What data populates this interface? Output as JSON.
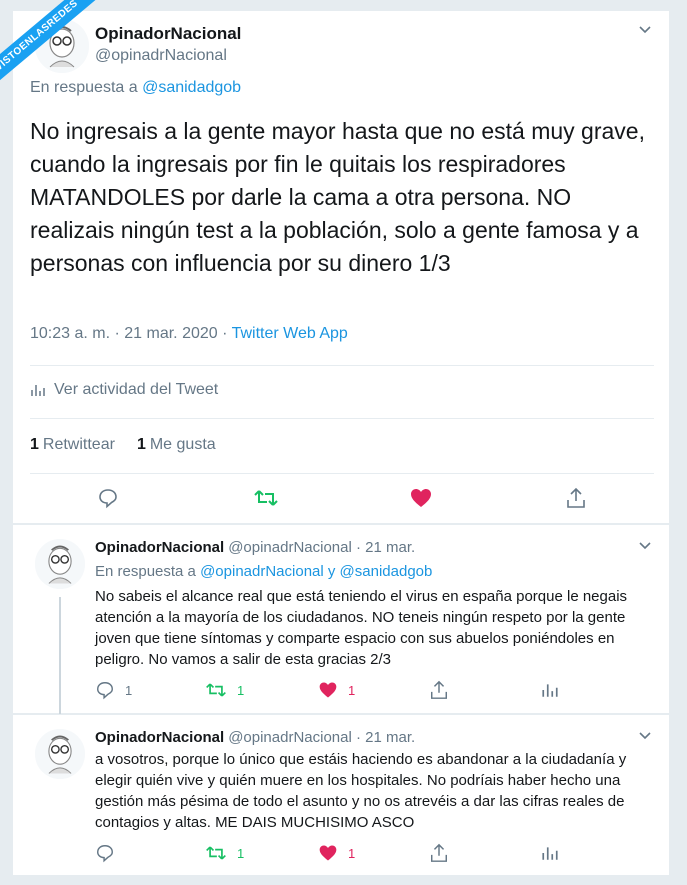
{
  "watermark": "VISTOENLASREDES",
  "colors": {
    "accent": "#1b95e0",
    "retweet_green": "#17bf63",
    "like_pink": "#e0245e",
    "muted": "#657786"
  },
  "main_tweet": {
    "name": "OpinadorNacional",
    "handle": "@opinadrNacional",
    "reply_prefix": "En respuesta a",
    "reply_to": "@sanidadgob",
    "text": "No ingresais a la gente mayor hasta que no está muy grave, cuando la ingresais por fin le quitais los respiradores MATANDOLES por darle la cama a otra persona. NO realizais ningún test a la población, solo a gente famosa y a personas con influencia por su dinero 1/3",
    "timestamp": "10:23 a. m. · 21 mar. 2020 ·",
    "source": "Twitter Web App",
    "activity_label": "Ver actividad del Tweet",
    "retweets_count": "1",
    "retweets_label": "Retwittear",
    "likes_count": "1",
    "likes_label": "Me gusta"
  },
  "replies": [
    {
      "name": "OpinadorNacional",
      "handle_date": "@opinadrNacional · 21 mar.",
      "reply_prefix": "En respuesta a",
      "reply_to": "@opinadrNacional y @sanidadgob",
      "text": "No sabeis el alcance real que está teniendo el virus en españa porque le negais atención a la mayoría de los ciudadanos. NO teneis ningún respeto por la gente joven que tiene síntomas y comparte espacio con sus abuelos poniéndoles en peligro. No vamos a salir de esta gracias 2/3",
      "reply_count": "1",
      "retweet_count": "1",
      "like_count": "1"
    },
    {
      "name": "OpinadorNacional",
      "handle_date": "@opinadrNacional · 21 mar.",
      "text": "a vosotros, porque lo único que estáis haciendo es abandonar a la ciudadanía y elegir quién vive y quién muere en los hospitales. No podríais haber hecho una gestión más pésima de todo el asunto y no os atrevéis a dar las cifras reales de contagios y altas. ME DAIS MUCHISIMO ASCO",
      "retweet_count": "1",
      "like_count": "1"
    }
  ]
}
